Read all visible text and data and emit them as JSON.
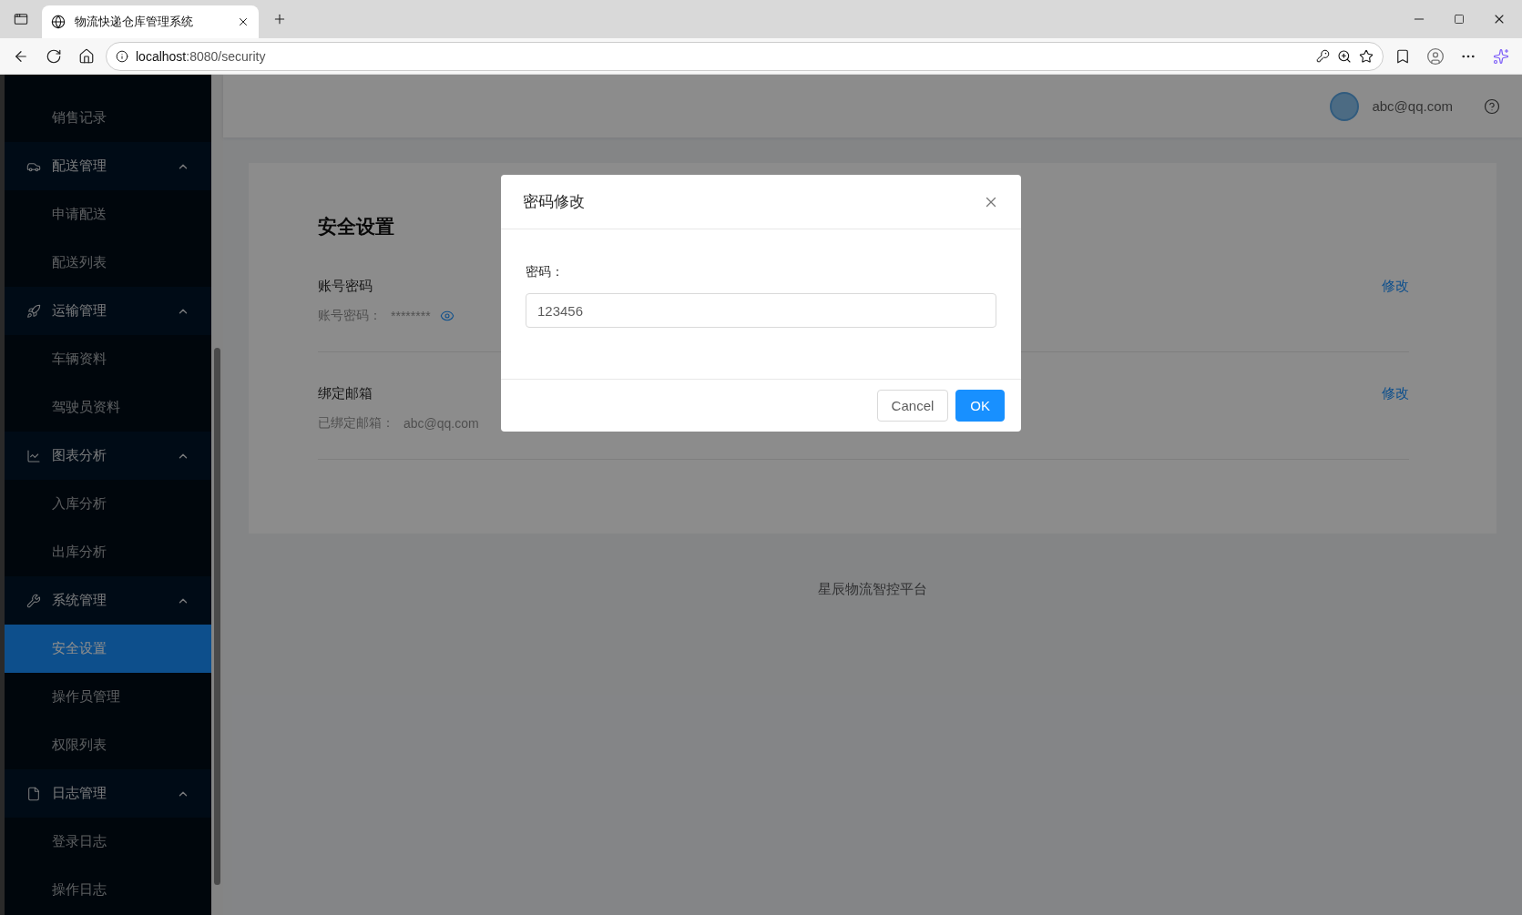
{
  "browser": {
    "tab_title": "物流快递仓库管理系统",
    "url_host": "localhost",
    "url_rest": ":8080/security"
  },
  "sidebar": {
    "orphan_items": [
      {
        "label": "销售记录",
        "selected": false
      }
    ],
    "groups": [
      {
        "label": "配送管理",
        "kind": "car",
        "expanded": true,
        "children": [
          {
            "label": "申请配送",
            "selected": false
          },
          {
            "label": "配送列表",
            "selected": false
          }
        ]
      },
      {
        "label": "运输管理",
        "kind": "rocket",
        "expanded": true,
        "children": [
          {
            "label": "车辆资料",
            "selected": false
          },
          {
            "label": "驾驶员资料",
            "selected": false
          }
        ]
      },
      {
        "label": "图表分析",
        "kind": "chart",
        "expanded": true,
        "children": [
          {
            "label": "入库分析",
            "selected": false
          },
          {
            "label": "出库分析",
            "selected": false
          }
        ]
      },
      {
        "label": "系统管理",
        "kind": "wrench",
        "expanded": true,
        "children": [
          {
            "label": "安全设置",
            "selected": true
          },
          {
            "label": "操作员管理",
            "selected": false
          },
          {
            "label": "权限列表",
            "selected": false
          }
        ]
      },
      {
        "label": "日志管理",
        "kind": "file",
        "expanded": true,
        "children": [
          {
            "label": "登录日志",
            "selected": false
          },
          {
            "label": "操作日志",
            "selected": false
          }
        ]
      }
    ]
  },
  "header": {
    "user": "abc@qq.com"
  },
  "settings": {
    "title": "安全设置",
    "rows": [
      {
        "kind": "password",
        "title": "账号密码",
        "label": "账号密码：",
        "value": "********",
        "action": "修改"
      },
      {
        "kind": "email",
        "title": "绑定邮箱",
        "label": "已绑定邮箱：",
        "value": "abc@qq.com",
        "action": "修改"
      }
    ]
  },
  "footer": "星辰物流智控平台",
  "modal": {
    "title": "密码修改",
    "field_label": "密码：",
    "field_value": "123456",
    "buttons": [
      {
        "label": "Cancel",
        "kind": "default"
      },
      {
        "label": "OK",
        "kind": "primary"
      }
    ]
  }
}
